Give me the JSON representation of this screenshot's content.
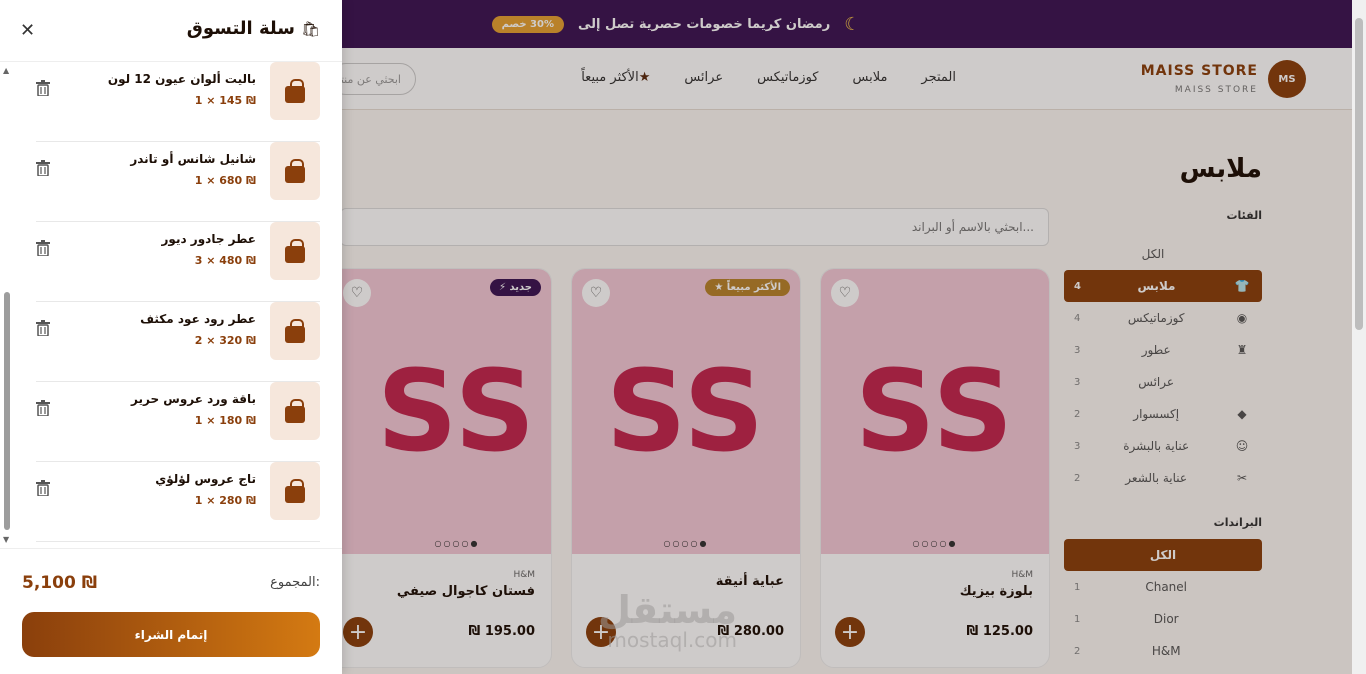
{
  "promo": {
    "text": "رمضان كريما خصومات حصرية تصل إلى",
    "badge": "30% خصم"
  },
  "brand": {
    "logo": "MS",
    "name": "MAISS STORE",
    "subtitle": "MAISS STORE"
  },
  "nav": {
    "links": [
      "المتجر",
      "ملابس",
      "كوزماتيكس",
      "عرائس",
      "الأكثر مبيعاً"
    ],
    "search_placeholder": "ابحثي عن منتج"
  },
  "section": {
    "title": "ملابس",
    "search_placeholder": "ابحثي بالاسم أو البراند..."
  },
  "sidebar": {
    "categories_title": "الفئات",
    "categories": [
      {
        "label": "الكل",
        "count": "",
        "icon": "none"
      },
      {
        "label": "ملابس",
        "count": "4",
        "icon": "tshirt-icon",
        "active": true
      },
      {
        "label": "كوزماتيكس",
        "count": "4",
        "icon": "palette-icon"
      },
      {
        "label": "عطور",
        "count": "3",
        "icon": "perfume-icon"
      },
      {
        "label": "عرائس",
        "count": "3",
        "icon": "none"
      },
      {
        "label": "إكسسوار",
        "count": "2",
        "icon": "gem-icon"
      },
      {
        "label": "عناية بالبشرة",
        "count": "3",
        "icon": "smile-icon"
      },
      {
        "label": "عناية بالشعر",
        "count": "2",
        "icon": "scissors-icon"
      }
    ],
    "brands_title": "البراندات",
    "brands": [
      {
        "label": "الكل",
        "count": "",
        "active": true
      },
      {
        "label": "Chanel",
        "count": "1"
      },
      {
        "label": "Dior",
        "count": "1"
      },
      {
        "label": "H&M",
        "count": "2"
      }
    ]
  },
  "products": [
    {
      "image_text": "SS",
      "brand": "H&M",
      "name": "بلوزة بيزيك",
      "price": "125.00 ₪",
      "badge": "",
      "dots": "○○○○●"
    },
    {
      "image_text": "SS",
      "brand": "",
      "name": "عباية أنيقة",
      "price": "280.00 ₪",
      "badge": "★ الأكثر مبيعاً",
      "dots": "○○○○●"
    },
    {
      "image_text": "SS",
      "brand": "H&M",
      "name": "فستان كاجوال صيفي",
      "price": "195.00 ₪",
      "badge": "⚡ جديد",
      "dots": "○○○○●"
    }
  ],
  "watermark": {
    "text": "مستقل",
    "url": "mostaql.com"
  },
  "cart": {
    "title": "سلة التسوق",
    "items": [
      {
        "name": "باليت ألوان عيون 12 لون",
        "qty": "₪ 145 × 1"
      },
      {
        "name": "شانيل شانس أو تاندر",
        "qty": "₪ 680 × 1"
      },
      {
        "name": "عطر جادور ديور",
        "qty": "₪ 480 × 3"
      },
      {
        "name": "عطر رود عود مكثف",
        "qty": "₪ 320 × 2"
      },
      {
        "name": "باقة ورد عروس حرير",
        "qty": "₪ 180 × 1"
      },
      {
        "name": "تاج عروس لؤلؤي",
        "qty": "₪ 280 × 1"
      }
    ],
    "total_label": "المجموع:",
    "total": "5,100 ₪",
    "checkout_label": "إتمام الشراء"
  },
  "colors": {
    "accent": "#8a3f0c",
    "promo_bg": "#3b1454",
    "product_bg": "#f3c8d6",
    "product_text": "#c2264f"
  }
}
